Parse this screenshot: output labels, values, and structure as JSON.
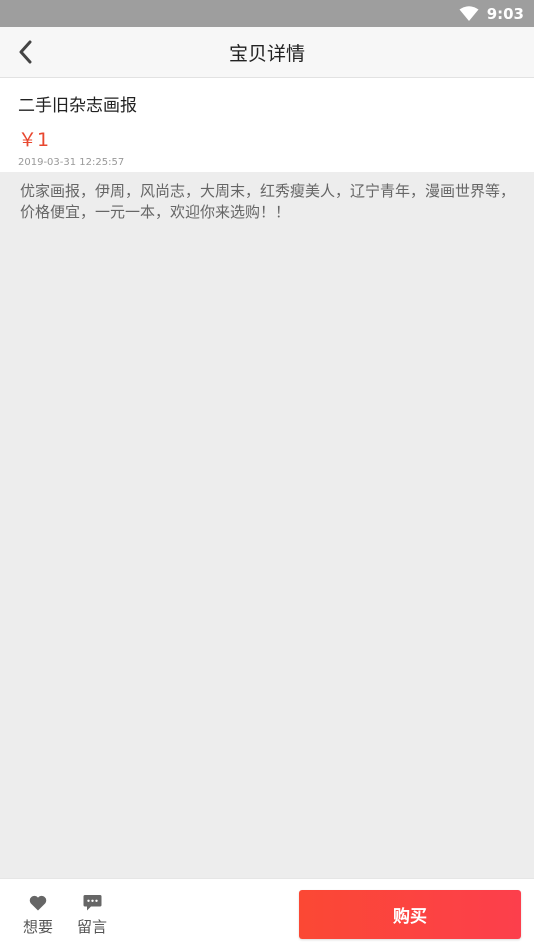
{
  "status_bar": {
    "time": "9:03",
    "wifi_icon": "wifi-icon"
  },
  "header": {
    "title": "宝贝详情",
    "back_icon": "chevron-left-icon"
  },
  "item": {
    "name": "二手旧杂志画报",
    "price": "￥1",
    "timestamp": "2019-03-31 12:25:57",
    "description": "优家画报，伊周，风尚志，大周末，红秀瘦美人，辽宁青年，漫画世界等，价格便宜，一元一本，欢迎你来选购！！"
  },
  "bottom_bar": {
    "want_label": "想要",
    "want_icon": "heart-icon",
    "message_label": "留言",
    "message_icon": "chat-bubble-icon",
    "buy_label": "购买"
  },
  "colors": {
    "price": "#e8472f",
    "buy_button": "#fb4834",
    "status_bar": "#9e9e9e",
    "background": "#ededed"
  }
}
